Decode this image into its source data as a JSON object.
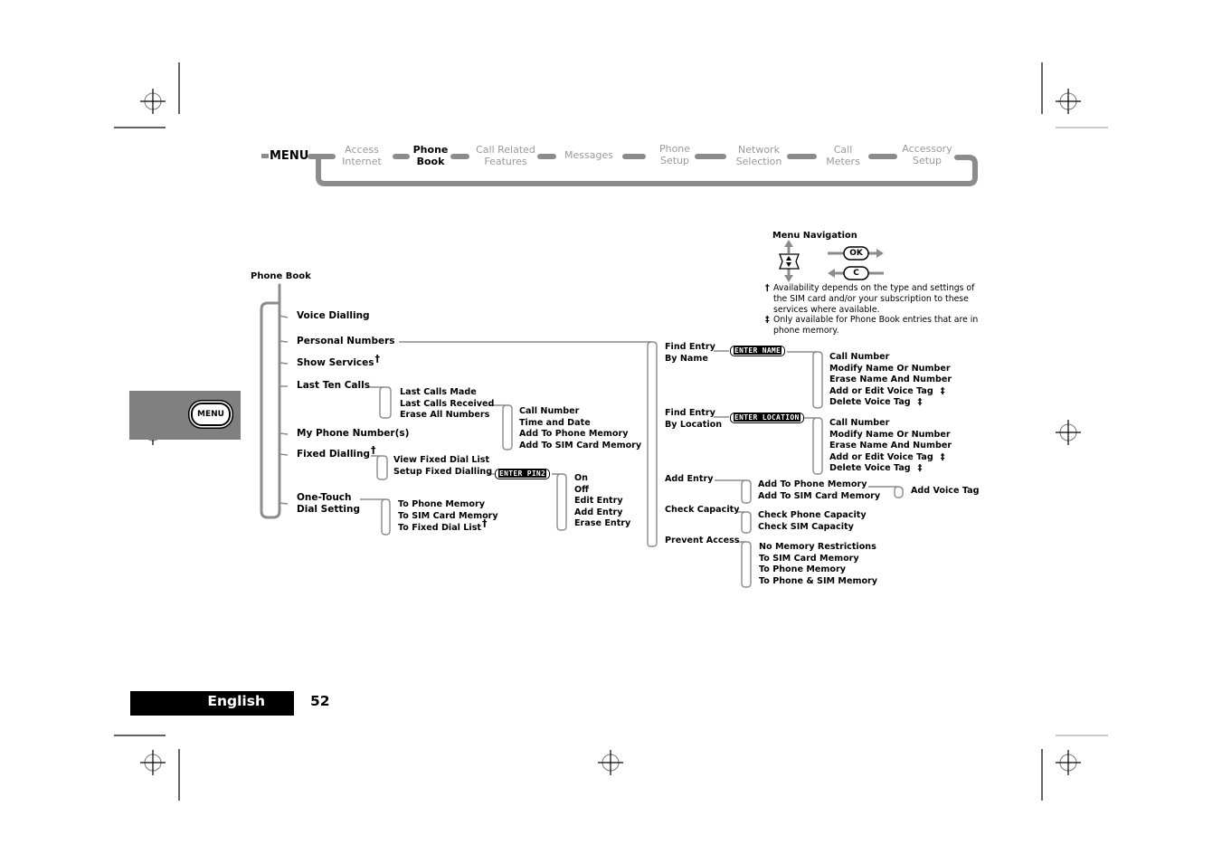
{
  "menu_bar": {
    "root_label": "MENU",
    "items": [
      {
        "line1": "Access",
        "line2": "Internet",
        "active": false
      },
      {
        "line1": "Phone",
        "line2": "Book",
        "active": true
      },
      {
        "line1": "Call Related",
        "line2": "Features",
        "active": false
      },
      {
        "line1": "Messages",
        "line2": "",
        "active": false
      },
      {
        "line1": "Phone",
        "line2": "Setup",
        "active": false
      },
      {
        "line1": "Network",
        "line2": "Selection",
        "active": false
      },
      {
        "line1": "Call",
        "line2": "Meters",
        "active": false
      },
      {
        "line1": "Accessory",
        "line2": "Setup",
        "active": false
      }
    ]
  },
  "legend": {
    "title": "Menu Navigation",
    "ok_key": "OK",
    "c_key": "C",
    "dagger_symbol": "†",
    "dagger_note": "Availability depends on the type and settings of the SIM card and/or your subscription to these services where available.",
    "ddagger_symbol": "‡",
    "ddagger_note": "Only available for Phone Book entries that are in phone memory."
  },
  "side_tab": {
    "button_label": "MENU"
  },
  "footer": {
    "language": "English",
    "page_number": "52"
  },
  "tree": {
    "root": "Phone Book",
    "level1": [
      "Voice Dialling",
      "Personal Numbers",
      "Show Services",
      "Last Ten Calls",
      "My Phone Number(s)",
      "Fixed Dialling",
      "One-Touch\nDial Setting"
    ],
    "dagger": "†",
    "ddagger": "‡",
    "last_ten_calls": [
      "Last Calls Made",
      "Last Calls Received",
      "Erase All Numbers"
    ],
    "calls_received_options": [
      "Call Number",
      "Time and Date",
      "Add To Phone Memory",
      "Add To SIM Card Memory"
    ],
    "fixed_dialling": [
      "View Fixed Dial List",
      "Setup Fixed Dialling"
    ],
    "enter_pin2": "ENTER PIN2",
    "setup_fixed_options": [
      "On",
      "Off",
      "Edit Entry",
      "Add Entry",
      "Erase Entry"
    ],
    "one_touch": [
      "To Phone Memory",
      "To SIM Card Memory",
      "To Fixed Dial List"
    ],
    "personal_numbers": {
      "find_by_name": "Find Entry\nBy Name",
      "find_by_location": "Find Entry\nBy Location",
      "add_entry": "Add Entry",
      "check_capacity": "Check Capacity",
      "prevent_access": "Prevent Access"
    },
    "enter_name": "ENTER NAME",
    "enter_location": "ENTER LOCATION",
    "entry_options": [
      "Call Number",
      "Modify Name Or Number",
      "Erase Name And Number",
      "Add or Edit Voice Tag",
      "Delete Voice Tag"
    ],
    "add_entry_options": [
      "Add To Phone Memory",
      "Add To SIM Card Memory"
    ],
    "add_voice_tag": "Add Voice Tag",
    "capacity_options": [
      "Check Phone Capacity",
      "Check SIM Capacity"
    ],
    "prevent_options": [
      "No Memory Restrictions",
      "To SIM Card Memory",
      "To Phone Memory",
      "To Phone & SIM Memory"
    ]
  }
}
